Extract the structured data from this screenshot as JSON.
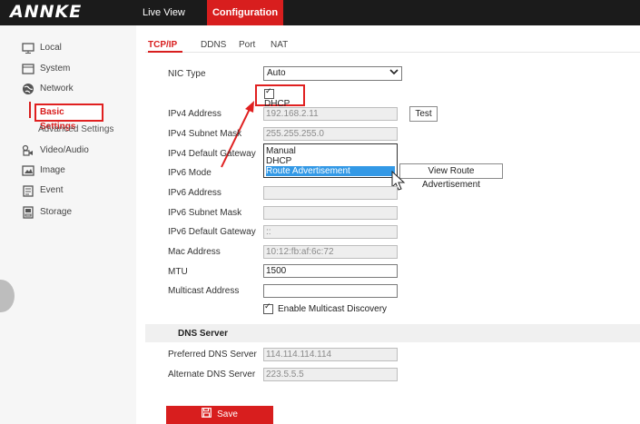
{
  "brand": {
    "logo_text": "ANNKE"
  },
  "topnav": {
    "live_view": "Live View",
    "configuration": "Configuration"
  },
  "sidebar": {
    "items": [
      {
        "label": "Local",
        "icon": "monitor-icon"
      },
      {
        "label": "System",
        "icon": "system-icon"
      },
      {
        "label": "Network",
        "icon": "network-globe-icon"
      },
      {
        "label": "Video/Audio",
        "icon": "video-audio-icon"
      },
      {
        "label": "Image",
        "icon": "image-icon"
      },
      {
        "label": "Event",
        "icon": "event-icon"
      },
      {
        "label": "Storage",
        "icon": "storage-icon"
      }
    ],
    "network_sub": {
      "basic": "Basic Settings",
      "advanced": "Advanced Settings"
    }
  },
  "tabs": [
    "TCP/IP",
    "DDNS",
    "Port",
    "NAT"
  ],
  "form": {
    "nic_type": {
      "label": "NIC Type",
      "value": "Auto"
    },
    "dhcp": {
      "label": "DHCP",
      "checked": true
    },
    "ipv4_address": {
      "label": "IPv4 Address",
      "value": "192.168.2.11"
    },
    "test_button": "Test",
    "ipv4_mask": {
      "label": "IPv4 Subnet Mask",
      "value": "255.255.255.0"
    },
    "ipv4_gateway": {
      "label": "IPv4 Default Gateway"
    },
    "ipv6_mode": {
      "label": "IPv6 Mode",
      "options": [
        "Manual",
        "DHCP",
        "Route Advertisement"
      ],
      "selected": "Route Advertisement"
    },
    "view_route_button": "View Route Advertisement",
    "ipv6_address": {
      "label": "IPv6 Address",
      "value": ""
    },
    "ipv6_mask": {
      "label": "IPv6 Subnet Mask",
      "value": ""
    },
    "ipv6_gateway": {
      "label": "IPv6 Default Gateway",
      "value": "::"
    },
    "mac": {
      "label": "Mac Address",
      "value": "10:12:fb:af:6c:72"
    },
    "mtu": {
      "label": "MTU",
      "value": "1500"
    },
    "multicast": {
      "label": "Multicast Address",
      "value": ""
    },
    "enable_multicast": {
      "label": "Enable Multicast Discovery",
      "checked": true
    }
  },
  "dns": {
    "title": "DNS Server",
    "preferred": {
      "label": "Preferred DNS Server",
      "value": "114.114.114.114"
    },
    "alternate": {
      "label": "Alternate DNS Server",
      "value": "223.5.5.5"
    }
  },
  "save_label": "Save",
  "colors": {
    "accent": "#d81e1e",
    "topbar": "#1b1b1b",
    "highlight_blue": "#3399e6",
    "annotation_red": "#e02020"
  }
}
